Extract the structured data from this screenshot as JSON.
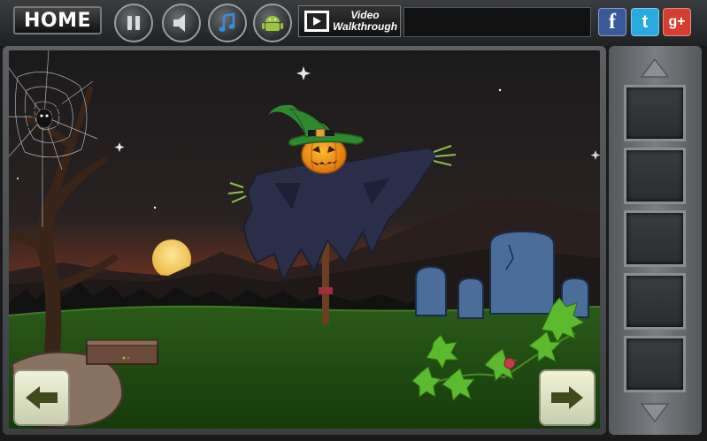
{
  "topbar": {
    "home_label": "HOME",
    "video_line1": "Video",
    "video_line2": "Walkthrough",
    "buttons": [
      "pause",
      "sound",
      "music",
      "android"
    ],
    "social": {
      "facebook": "f",
      "twitter": "t",
      "googleplus": "g+"
    }
  },
  "colors": {
    "sky_top": "#1c1b1c",
    "sky_horizon": "#7a3b24",
    "grass": "#1f4a13",
    "moon": "#f2c94c",
    "pumpkin": "#f39c12",
    "hat": "#2e8b2e",
    "robe": "#2c2f4a",
    "tombstone": "#4a6d9a",
    "nav_button": "#e7e9cd",
    "facebook": "#3b5998",
    "twitter": "#2aa9e0",
    "googleplus": "#d23f31"
  },
  "inventory": {
    "slot_count": 5
  },
  "icons": {
    "pause": "pause-icon",
    "sound": "speaker-icon",
    "music": "music-note-icon",
    "android": "android-icon",
    "video": "film-icon",
    "left": "arrow-left-icon",
    "right": "arrow-right-icon",
    "up": "triangle-up-icon",
    "down": "triangle-down-icon"
  }
}
